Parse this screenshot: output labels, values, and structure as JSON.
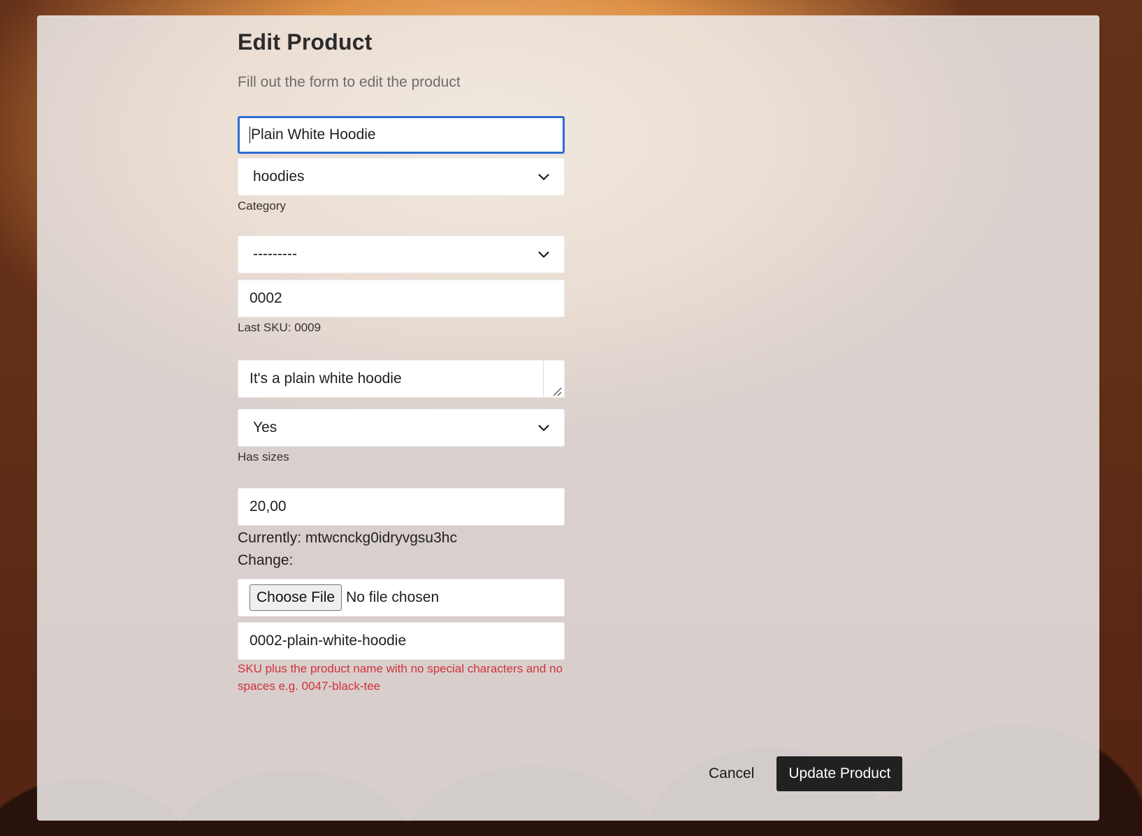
{
  "page": {
    "title": "Edit Product",
    "subtitle": "Fill out the form to edit the product"
  },
  "form": {
    "name": {
      "value": "Plain White Hoodie"
    },
    "category": {
      "value": "hoodies",
      "help": "Category"
    },
    "sub_category": {
      "value": "---------"
    },
    "sku": {
      "value": "0002",
      "help": "Last SKU: 0009"
    },
    "description": {
      "value": "It's a plain white hoodie"
    },
    "has_sizes": {
      "value": "Yes",
      "help": "Has sizes"
    },
    "price": {
      "value": "20,00"
    },
    "image": {
      "currently_label": "Currently:",
      "currently_value": "mtwcnckg0idryvgsu3hc",
      "change_label": "Change:",
      "button_label": "Choose File",
      "status": "No file chosen"
    },
    "slug": {
      "value": "0002-plain-white-hoodie",
      "help": "SKU plus the product name with no special characters and no spaces e.g. 0047-black-tee"
    }
  },
  "actions": {
    "cancel_label": "Cancel",
    "submit_label": "Update Product"
  },
  "colors": {
    "focus_border": "#2e6bd1",
    "error_text": "#d0323d",
    "primary_button": "#212121"
  }
}
